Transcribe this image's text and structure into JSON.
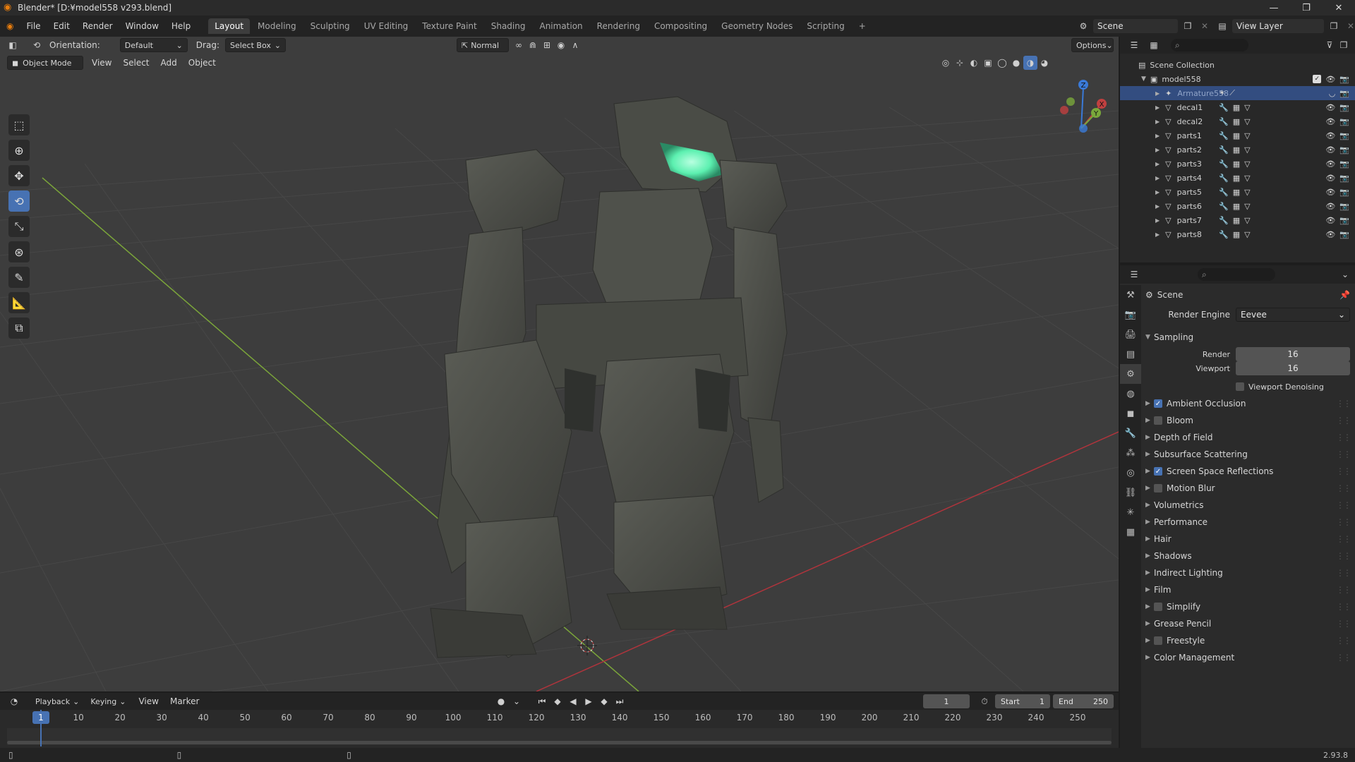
{
  "window": {
    "title": "Blender* [D:¥model558 v293.blend]",
    "controls": [
      "—",
      "❐",
      "✕"
    ]
  },
  "menubar": {
    "menus": [
      "File",
      "Edit",
      "Render",
      "Window",
      "Help"
    ],
    "workspaces": [
      "Layout",
      "Modeling",
      "Sculpting",
      "UV Editing",
      "Texture Paint",
      "Shading",
      "Animation",
      "Rendering",
      "Compositing",
      "Geometry Nodes",
      "Scripting"
    ],
    "active_workspace": "Layout",
    "scene_name": "Scene",
    "view_layer": "View Layer"
  },
  "viewport": {
    "orientation_label": "Orientation:",
    "orientation_value": "Default",
    "drag_label": "Drag:",
    "drag_value": "Select Box",
    "pivot_value": "Normal",
    "options_label": "Options",
    "mode": "Object Mode",
    "menus": [
      "View",
      "Select",
      "Add",
      "Object"
    ],
    "gizmo_axes": [
      "X",
      "Y",
      "Z"
    ]
  },
  "outliner": {
    "root": "Scene Collection",
    "collection": "model558",
    "items": [
      "Armature558",
      "decal1",
      "decal2",
      "parts1",
      "parts2",
      "parts3",
      "parts4",
      "parts5",
      "parts6",
      "parts7",
      "parts8"
    ],
    "selected_item": "Armature558"
  },
  "properties": {
    "context": "Scene",
    "render_engine_label": "Render Engine",
    "render_engine_value": "Eevee",
    "sampling_label": "Sampling",
    "render_label": "Render",
    "render_samples": "16",
    "viewport_label": "Viewport",
    "viewport_samples": "16",
    "viewport_denoising_label": "Viewport Denoising",
    "panels": [
      {
        "label": "Ambient Occlusion",
        "checkbox": true,
        "checked": true
      },
      {
        "label": "Bloom",
        "checkbox": true,
        "checked": false
      },
      {
        "label": "Depth of Field",
        "checkbox": false,
        "checked": false
      },
      {
        "label": "Subsurface Scattering",
        "checkbox": false,
        "checked": false
      },
      {
        "label": "Screen Space Reflections",
        "checkbox": true,
        "checked": true
      },
      {
        "label": "Motion Blur",
        "checkbox": true,
        "checked": false
      },
      {
        "label": "Volumetrics",
        "checkbox": false,
        "checked": false
      },
      {
        "label": "Performance",
        "checkbox": false,
        "checked": false
      },
      {
        "label": "Hair",
        "checkbox": false,
        "checked": false
      },
      {
        "label": "Shadows",
        "checkbox": false,
        "checked": false
      },
      {
        "label": "Indirect Lighting",
        "checkbox": false,
        "checked": false
      },
      {
        "label": "Film",
        "checkbox": false,
        "checked": false
      },
      {
        "label": "Simplify",
        "checkbox": true,
        "checked": false
      },
      {
        "label": "Grease Pencil",
        "checkbox": false,
        "checked": false
      },
      {
        "label": "Freestyle",
        "checkbox": true,
        "checked": false
      },
      {
        "label": "Color Management",
        "checkbox": false,
        "checked": false
      }
    ]
  },
  "timeline": {
    "menus": [
      "Playback",
      "Keying",
      "View",
      "Marker"
    ],
    "current_frame": "1",
    "start_label": "Start",
    "start_value": "1",
    "end_label": "End",
    "end_value": "250",
    "ticks": [
      "1",
      "10",
      "20",
      "30",
      "40",
      "50",
      "60",
      "70",
      "80",
      "90",
      "100",
      "110",
      "120",
      "130",
      "140",
      "150",
      "160",
      "170",
      "180",
      "190",
      "200",
      "210",
      "220",
      "230",
      "240",
      "250"
    ]
  },
  "statusbar": {
    "version": "2.93.8"
  },
  "colors": {
    "accent": "#4772b3",
    "grid_x_axis": "#b0343c",
    "grid_y_axis": "#7ba53a",
    "visor_glow": "#5cf0b0"
  }
}
